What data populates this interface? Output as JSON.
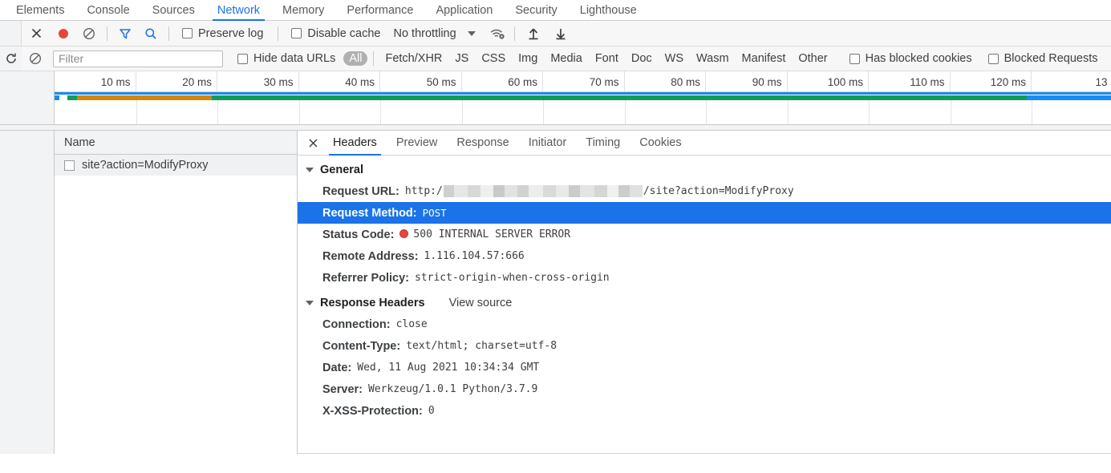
{
  "devtools": {
    "tabs": [
      {
        "label": "Elements",
        "active": false
      },
      {
        "label": "Console",
        "active": false
      },
      {
        "label": "Sources",
        "active": false
      },
      {
        "label": "Network",
        "active": true
      },
      {
        "label": "Memory",
        "active": false
      },
      {
        "label": "Performance",
        "active": false
      },
      {
        "label": "Application",
        "active": false
      },
      {
        "label": "Security",
        "active": false
      },
      {
        "label": "Lighthouse",
        "active": false
      }
    ],
    "accent_color": "#1a73e8"
  },
  "toolbar": {
    "icons": {
      "clear_close": "close-icon",
      "record": "record-icon",
      "clear": "clear-icon",
      "filter": "filter-icon",
      "search": "search-icon",
      "wifi": "network-conditions-icon",
      "import": "import-har-icon",
      "export": "export-har-icon"
    },
    "preserve_log": {
      "label": "Preserve log",
      "checked": false
    },
    "disable_cache": {
      "label": "Disable cache",
      "checked": false
    },
    "throttling": {
      "value": "No throttling"
    },
    "record_color": "#e8463a"
  },
  "filterbar": {
    "reload_icon": "reload-icon",
    "clear_icon": "clear-icon",
    "search": {
      "placeholder": "Filter",
      "value": ""
    },
    "hide_data_urls": {
      "label": "Hide data URLs",
      "checked": false
    },
    "types": [
      {
        "label": "All",
        "active": true
      },
      {
        "label": "Fetch/XHR",
        "active": false
      },
      {
        "label": "JS",
        "active": false
      },
      {
        "label": "CSS",
        "active": false
      },
      {
        "label": "Img",
        "active": false
      },
      {
        "label": "Media",
        "active": false
      },
      {
        "label": "Font",
        "active": false
      },
      {
        "label": "Doc",
        "active": false
      },
      {
        "label": "WS",
        "active": false
      },
      {
        "label": "Wasm",
        "active": false
      },
      {
        "label": "Manifest",
        "active": false
      },
      {
        "label": "Other",
        "active": false
      }
    ],
    "has_blocked_cookies": {
      "label": "Has blocked cookies",
      "checked": false
    },
    "blocked_requests": {
      "label": "Blocked Requests",
      "checked": false
    }
  },
  "overview": {
    "ticks": [
      "10 ms",
      "20 ms",
      "30 ms",
      "40 ms",
      "50 ms",
      "60 ms",
      "70 ms",
      "80 ms",
      "90 ms",
      "100 ms",
      "110 ms",
      "120 ms",
      "13"
    ],
    "bar_segments": [
      {
        "name": "queueing",
        "color": "#1a8bf0",
        "start_pct": 0.0,
        "width_pct": 0.45
      },
      {
        "name": "stalled",
        "color": "#ffffff",
        "start_pct": 0.45,
        "width_pct": 0.75
      },
      {
        "name": "dns",
        "color": "#0f9d58",
        "start_pct": 1.2,
        "width_pct": 0.9
      },
      {
        "name": "request-sent",
        "color": "#d2860b",
        "start_pct": 2.1,
        "width_pct": 12.8
      },
      {
        "name": "waiting",
        "color": "#0f9d58",
        "start_pct": 14.9,
        "width_pct": 77.1
      },
      {
        "name": "content-download",
        "color": "#1a8bf0",
        "start_pct": 92.0,
        "width_pct": 8.0
      }
    ],
    "top_line_color": "#1a8bf0"
  },
  "request_list": {
    "column_header": "Name",
    "rows": [
      {
        "name": "site?action=ModifyProxy",
        "selected": true,
        "favicon": "generic-document-icon"
      }
    ]
  },
  "details": {
    "close_icon": "close-icon",
    "tabs": [
      {
        "label": "Headers",
        "active": true
      },
      {
        "label": "Preview",
        "active": false
      },
      {
        "label": "Response",
        "active": false
      },
      {
        "label": "Initiator",
        "active": false
      },
      {
        "label": "Timing",
        "active": false
      },
      {
        "label": "Cookies",
        "active": false
      }
    ],
    "general": {
      "title": "General",
      "expanded": true,
      "rows": [
        {
          "key": "Request URL:",
          "value_prefix": "http:/",
          "redacted": true,
          "value_suffix": "/site?action=ModifyProxy",
          "selected": false
        },
        {
          "key": "Request Method:",
          "value": "POST",
          "selected": true
        },
        {
          "key": "Status Code:",
          "value": "500 INTERNAL SERVER ERROR",
          "status_dot": true,
          "status_color": "#e8463a",
          "selected": false
        },
        {
          "key": "Remote Address:",
          "value": "1.116.104.57:666",
          "selected": false
        },
        {
          "key": "Referrer Policy:",
          "value": "strict-origin-when-cross-origin",
          "selected": false
        }
      ]
    },
    "response_headers": {
      "title": "Response Headers",
      "view_source": "View source",
      "expanded": true,
      "rows": [
        {
          "key": "Connection:",
          "value": "close"
        },
        {
          "key": "Content-Type:",
          "value": "text/html; charset=utf-8"
        },
        {
          "key": "Date:",
          "value": "Wed, 11 Aug 2021 10:34:34 GMT"
        },
        {
          "key": "Server:",
          "value": "Werkzeug/1.0.1 Python/3.7.9"
        },
        {
          "key": "X-XSS-Protection:",
          "value": "0"
        }
      ]
    }
  }
}
